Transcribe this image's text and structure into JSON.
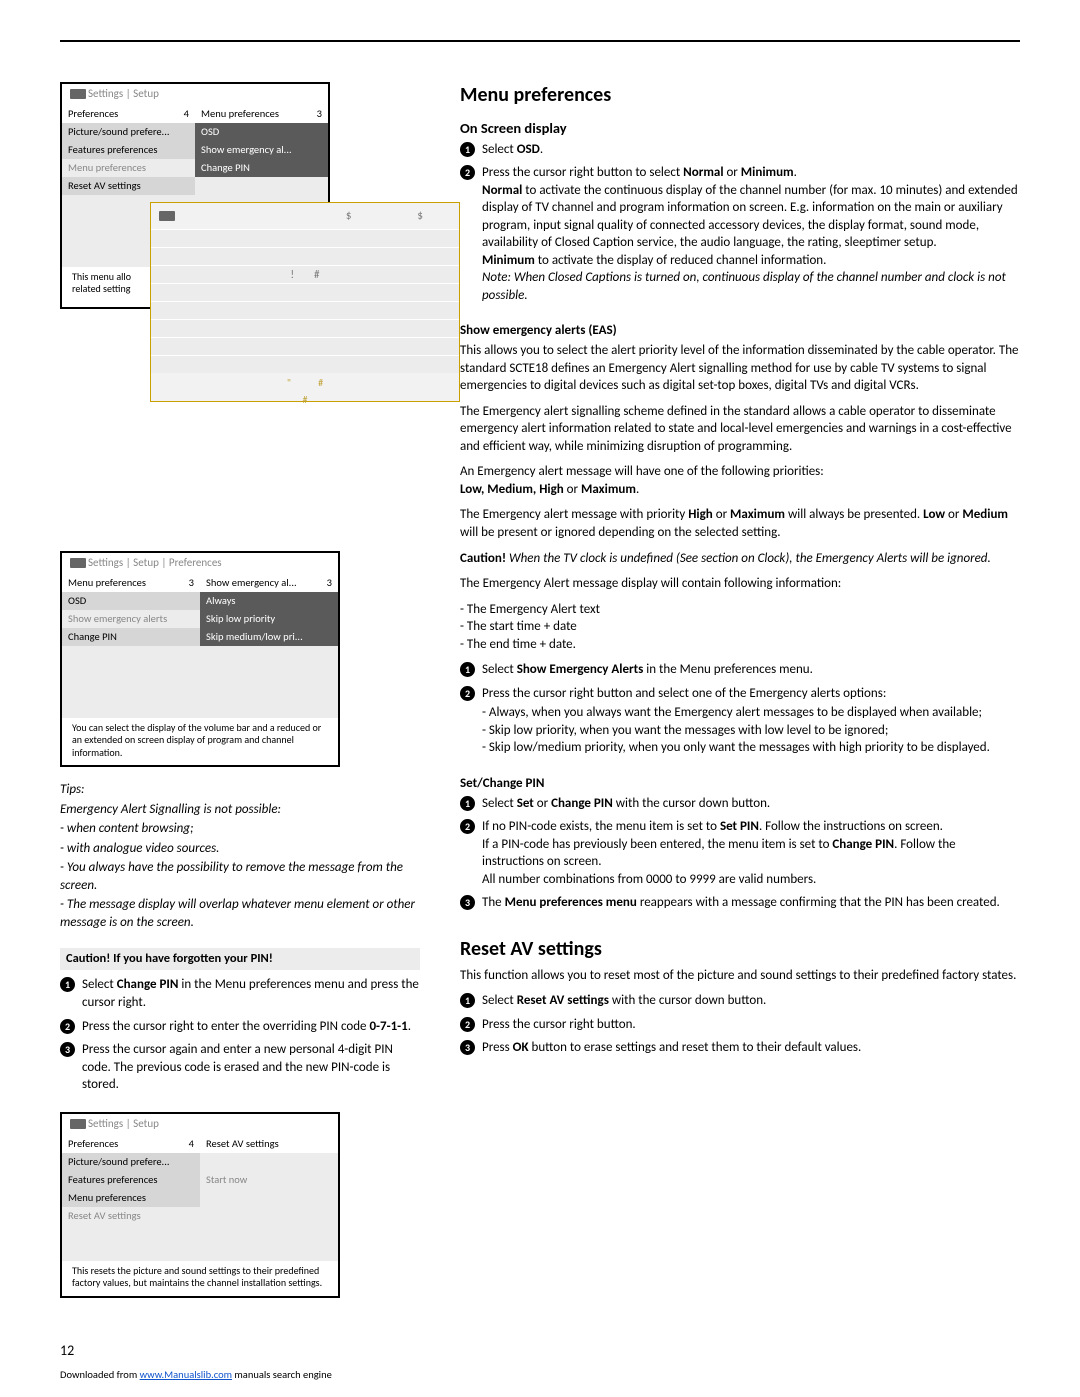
{
  "page_number": "12",
  "footer": {
    "pre": "Downloaded from ",
    "link": "www.Manualslib.com",
    "post": " manuals search engine"
  },
  "menu1": {
    "breadcrumb": "Settings | Setup",
    "colA_header_left": "Preferences",
    "colA_header_right": "4",
    "colB_header_left": "Menu preferences",
    "colB_header_right": "3",
    "a1": "Picture/sound prefere...",
    "a2": "Features preferences",
    "a3": "Menu preferences",
    "a4": "Reset AV settings",
    "b1": "OSD",
    "b2": "Show emergency al...",
    "b3": "Change PIN",
    "caption_l1": "This menu allo",
    "caption_l2": "related setting"
  },
  "overlay": {
    "sym_a": "$",
    "sym_b": "$",
    "row_excl": "!",
    "row_hash1": "#",
    "foot_quote": "\"",
    "foot_hash": "#"
  },
  "menu2": {
    "breadcrumb": "Settings | Setup | Preferences",
    "colA_header_left": "Menu preferences",
    "colA_header_right": "3",
    "colB_header_left": "Show emergency al...",
    "colB_header_right": "3",
    "a1": "OSD",
    "a2": "Show emergency alerts",
    "a3": "Change PIN",
    "b1": "Always",
    "b2": "Skip low priority",
    "b3": "Skip medium/low pri...",
    "caption": "You can select the display of the volume bar and a reduced or an extended on screen display of program and channel information."
  },
  "tips": {
    "title": "Tips:",
    "l1": "Emergency Alert Signalling is not possible:",
    "l2": "- when content browsing;",
    "l3": "- with analogue video sources.",
    "l4": "- You always have the possibility to remove the message from the screen.",
    "l5": "- The message display will overlap whatever menu element or other message is on the screen."
  },
  "caution_pin": {
    "title": "Caution! If you have forgotten your PIN!",
    "s1a": "Select ",
    "s1b": "Change PIN",
    "s1c": " in the Menu preferences menu and press the cursor right.",
    "s2a": "Press the cursor right to enter the overriding PIN code ",
    "s2b": "0-7-1-1",
    "s2c": ".",
    "s3": "Press the cursor again and enter a new personal 4-digit PIN code. The previous code is erased and the new PIN-code is stored."
  },
  "menu3": {
    "breadcrumb": "Settings | Setup",
    "colA_header_left": "Preferences",
    "colA_header_right": "4",
    "colB_header_left": "Reset AV settings",
    "colB_header_right": "",
    "a1": "Picture/sound prefere...",
    "a2": "Features preferences",
    "a3": "Menu preferences",
    "a4": "Reset AV settings",
    "b2": "Start now",
    "caption": "This resets the picture and sound settings to their predefined factory values, but maintains the channel installation settings."
  },
  "right": {
    "h_menu_pref": "Menu preferences",
    "h_osd": "On Screen display",
    "osd1a": "Select ",
    "osd1b": "OSD",
    "osd1c": ".",
    "osd2a": "Press the cursor right button to select ",
    "osd2b": "Normal",
    "osd2c": " or ",
    "osd2d": "Minimum",
    "osd2e": ".",
    "osd_normal_b": "Normal",
    "osd_normal_txt": " to activate the continuous display of the channel number (for max. 10 minutes) and extended display of TV channel and program information on screen. E.g. information on the main or auxiliary program, input signal quality of connected accessory devices, the display format, sound mode, availability of Closed Caption service, the audio language, the rating, sleeptimer setup.",
    "osd_min_b": "Minimum",
    "osd_min_txt": " to activate the display of reduced channel information.",
    "osd_note": "Note: When Closed Captions is turned on, continuous display of the channel number and clock is not possible.",
    "h_eas": "Show emergency alerts (EAS)",
    "eas_p1": "This allows you to select the alert priority level of the information disseminated by the cable operator. The standard SCTE18 defines an Emergency Alert signalling method for use by cable TV systems to signal emergencies to digital devices such as digital set-top boxes, digital TVs and digital VCRs.",
    "eas_p2": "The Emergency alert signalling scheme defined in the standard allows a cable operator to disseminate emergency alert information related to state and local-level emergencies and warnings in a cost-effective and efficient way, while minimizing disruption of programming.",
    "eas_p3": "An Emergency alert message will have one of the following priorities:",
    "eas_prio": "Low, Medium, High",
    "eas_prio_or": " or ",
    "eas_prio_max": "Maximum",
    "eas_prio_dot": ".",
    "eas_p4a": "The Emergency alert message with priority ",
    "eas_p4b": "High",
    "eas_p4c": " or ",
    "eas_p4d": "Maximum",
    "eas_p4e": " will always be presented. ",
    "eas_p4f": "Low",
    "eas_p4g": " or ",
    "eas_p4h": "Medium",
    "eas_p4i": " will be present or ignored depending on the selected setting.",
    "eas_caution_b": "Caution!",
    "eas_caution_txt": " When the TV clock is undefined (See section on Clock), the Emergency Alerts will be ignored.",
    "eas_p5": "The Emergency Alert message display will contain following information:",
    "eas_li1": "The Emergency Alert text",
    "eas_li2": "The start time + date",
    "eas_li3": "The end time + date.",
    "eas_s1a": "Select ",
    "eas_s1b": "Show Emergency Alerts",
    "eas_s1c": " in the Menu preferences menu.",
    "eas_s2": "Press the cursor right button and select one of the Emergency alerts options:",
    "eas_s2_li1": "Always, when you always want the Emergency alert messages to be displayed when available;",
    "eas_s2_li2": "Skip low priority, when you want the messages with low level to be ignored;",
    "eas_s2_li3": "Skip low/medium priority, when you only want the messages with high priority to be displayed.",
    "h_pin": "Set/Change PIN",
    "pin1a": "Select ",
    "pin1b": "Set",
    "pin1c": " or ",
    "pin1d": "Change PIN",
    "pin1e": " with the cursor down button.",
    "pin2a": "If no PIN-code exists, the menu item is set to ",
    "pin2b": "Set PIN",
    "pin2c": ". Follow the instructions on screen.",
    "pin2d": "If a PIN-code has previously been entered, the menu item is set to ",
    "pin2e": "Change PIN",
    "pin2f": ". Follow the instructions on screen.",
    "pin2g": "All number combinations from 0000 to 9999 are valid numbers.",
    "pin3a": "The ",
    "pin3b": "Menu preferences menu",
    "pin3c": " reappears with a message confirming that the PIN has been created.",
    "h_reset": "Reset AV settings",
    "reset_p": "This function allows you to reset most of the picture and sound settings to their predefined factory states.",
    "reset1a": "Select ",
    "reset1b": "Reset AV settings",
    "reset1c": " with the cursor down button.",
    "reset2": "Press the cursor right button.",
    "reset3a": "Press ",
    "reset3b": "OK",
    "reset3c": " button to erase settings and reset them to their default values."
  }
}
